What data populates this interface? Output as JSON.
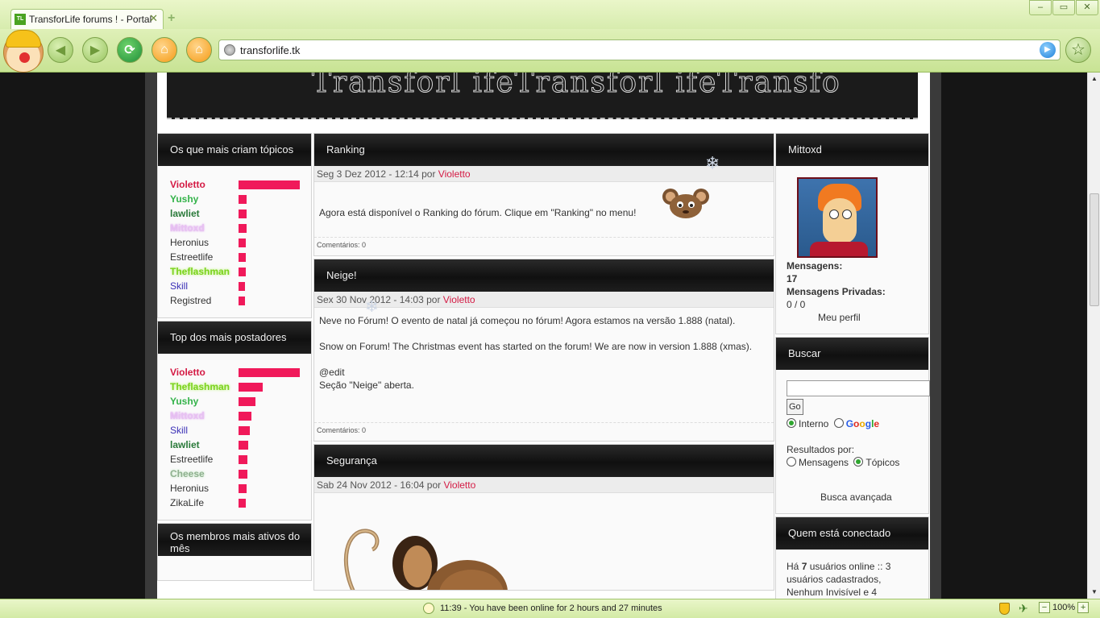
{
  "browser": {
    "tab_title": "TransforLife forums ! - Portal",
    "url": "transforlife.tk",
    "window_controls": [
      "–",
      "▭",
      "✕"
    ]
  },
  "banner_text": "Transforl ifeTransforl ifeTransfo",
  "left": {
    "topics_title": "Os que mais criam tópicos",
    "topics": [
      {
        "name": "Violetto",
        "style": "u-red",
        "bar": 76
      },
      {
        "name": "Yushy",
        "style": "u-green",
        "bar": 10
      },
      {
        "name": "lawliet",
        "style": "u-dgreen",
        "bar": 10
      },
      {
        "name": "Mittoxd",
        "style": "u-pink",
        "bar": 10
      },
      {
        "name": "Heronius",
        "style": "u-plain",
        "bar": 9
      },
      {
        "name": "Estreetlife",
        "style": "u-plain",
        "bar": 9
      },
      {
        "name": "Theflashman",
        "style": "u-glow",
        "bar": 9
      },
      {
        "name": "Skill",
        "style": "u-blue",
        "bar": 8
      },
      {
        "name": "Registred",
        "style": "u-plain",
        "bar": 8
      }
    ],
    "posters_title": "Top dos mais postadores",
    "posters": [
      {
        "name": "Violetto",
        "style": "u-red",
        "bar": 76
      },
      {
        "name": "Theflashman",
        "style": "u-glow",
        "bar": 30
      },
      {
        "name": "Yushy",
        "style": "u-green",
        "bar": 21
      },
      {
        "name": "Mittoxd",
        "style": "u-pink",
        "bar": 16
      },
      {
        "name": "Skill",
        "style": "u-blue",
        "bar": 14
      },
      {
        "name": "lawliet",
        "style": "u-dgreen",
        "bar": 12
      },
      {
        "name": "Estreetlife",
        "style": "u-plain",
        "bar": 11
      },
      {
        "name": "Cheese",
        "style": "u-grayglow",
        "bar": 11
      },
      {
        "name": "Heronius",
        "style": "u-plain",
        "bar": 10
      },
      {
        "name": "ZikaLife",
        "style": "u-plain",
        "bar": 9
      }
    ],
    "active_title": "Os membros mais ativos do mês"
  },
  "articles": [
    {
      "title": "Ranking",
      "meta": "Seg 3 Dez 2012 - 12:14 por",
      "author": "Violetto",
      "body": [
        "Agora está disponível o Ranking do fórum. Clique em \"Ranking\" no menu!"
      ],
      "comments": "Comentários: 0"
    },
    {
      "title": "Neige!",
      "meta": "Sex 30 Nov 2012 - 14:03 por",
      "author": "Violetto",
      "body": [
        "Neve no Fórum! O evento de natal já começou no fórum! Agora estamos na versão 1.888 (natal).",
        "Snow on Forum! The Christmas event has started on the forum! We are now in version 1.888 (xmas).",
        "@edit\nSeção \"Neige\" aberta."
      ],
      "comments": "Comentários: 0"
    },
    {
      "title": "Segurança",
      "meta": "Sab 24 Nov 2012 - 16:04 por",
      "author": "Violetto"
    }
  ],
  "right": {
    "profile_title": "Mittoxd",
    "messages_label": "Mensagens:",
    "messages_value": "17",
    "pm_label": "Mensagens Privadas:",
    "pm_value": "0 / 0",
    "profile_link": "Meu perfil",
    "search_title": "Buscar",
    "search_go": "Go",
    "opt_internal": "Interno",
    "google_letters": [
      "G",
      "o",
      "o",
      "g",
      "l",
      "e"
    ],
    "results_label": "Resultados por:",
    "opt_messages": "Mensagens",
    "opt_topics": "Tópicos",
    "advanced_link": "Busca avançada",
    "online_title": "Quem está conectado",
    "online_text_1": "Há ",
    "online_count": "7",
    "online_text_2": " usuários online :: 3 usuários cadastrados, Nenhum Invisível e 4"
  },
  "statusbar": {
    "text": "11:39 - You have been online for 2 hours and 27 minutes",
    "zoom": "100%"
  },
  "colors": {
    "accent_red": "#d41a44",
    "bar": "#f0195a",
    "chrome_green": "#d7ecae"
  }
}
